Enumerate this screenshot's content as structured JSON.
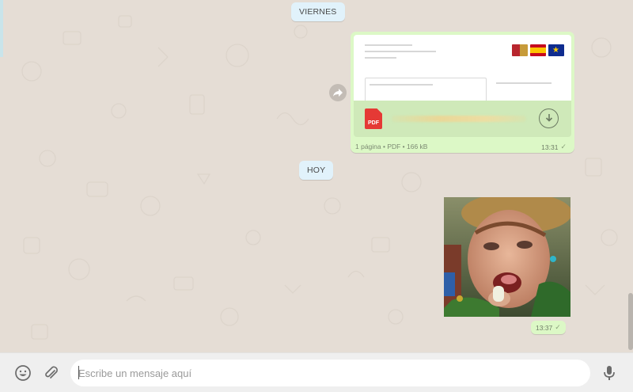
{
  "chat": {
    "date_labels": {
      "earlier": "VIERNES",
      "today": "HOY"
    },
    "document_message": {
      "icon": "pdf-icon",
      "type_label": "PDF",
      "meta": "1 página • PDF • 166 kB",
      "time": "13:31",
      "status_icon": "single-check-icon"
    },
    "image_message": {
      "time": "13:37",
      "status_icon": "single-check-icon"
    }
  },
  "composer": {
    "placeholder": "Escribe un mensaje aquí",
    "emoji_icon": "emoji-icon",
    "attach_icon": "paperclip-icon",
    "mic_icon": "microphone-icon"
  },
  "colors": {
    "wallpaper": "#e5ddd5",
    "outgoing_bubble": "#dcf8c6",
    "date_chip": "#e1f2fb",
    "composer_bar": "#efefef",
    "pdf_red": "#e53935"
  }
}
